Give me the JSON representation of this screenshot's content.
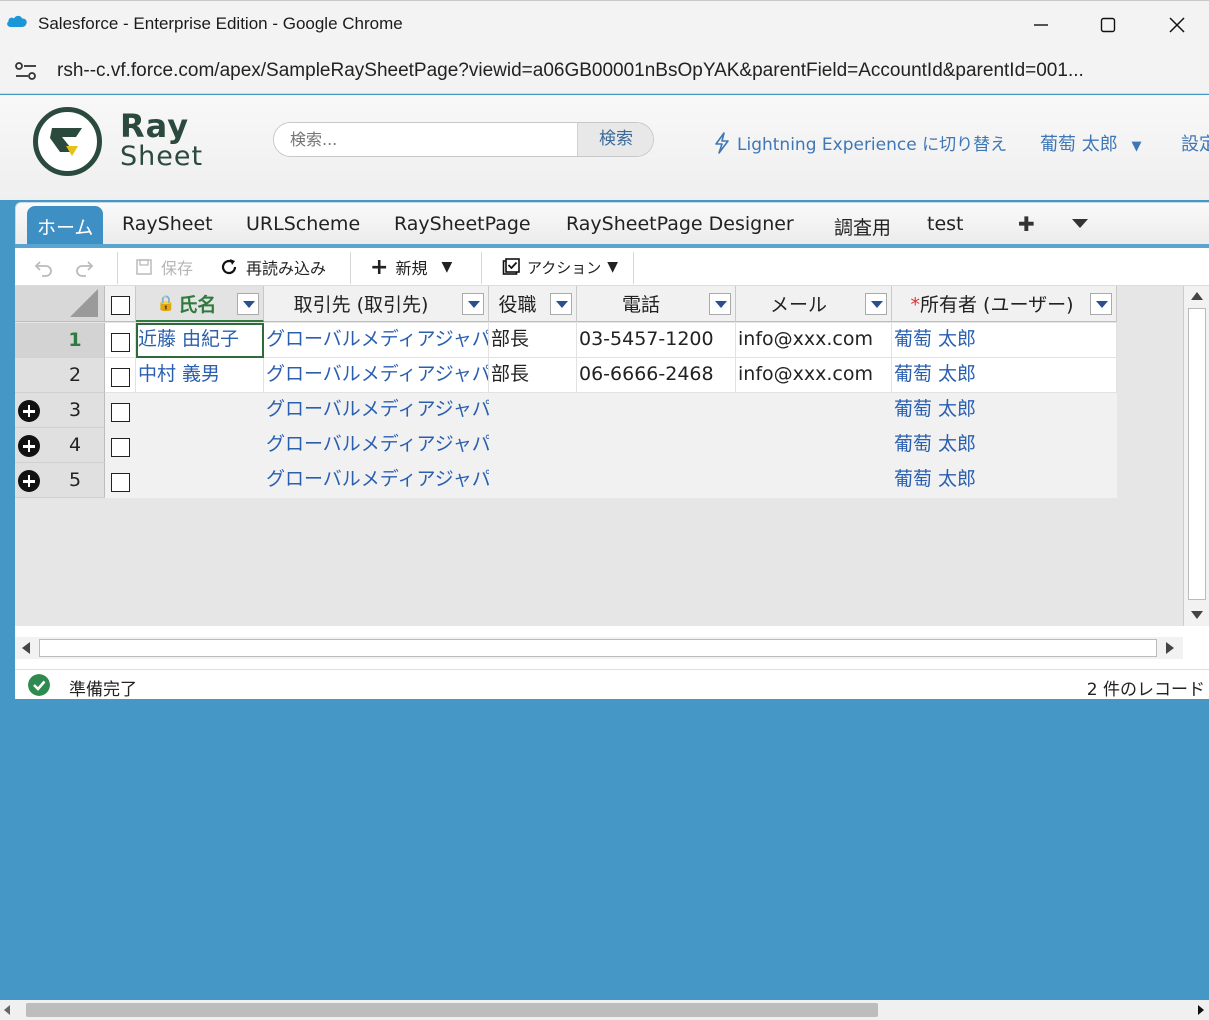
{
  "browser": {
    "title": "Salesforce - Enterprise Edition - Google Chrome",
    "url": "rsh--c.vf.force.com/apex/SampleRaySheetPage?viewid=a06GB00001nBsOpYAK&parentField=AccountId&parentId=001..."
  },
  "header": {
    "logo_top": "Ray",
    "logo_bottom": "Sheet",
    "search_placeholder": "検索...",
    "search_button": "検索",
    "lightning_link": "Lightning Experience に切り替え",
    "user_name": "葡萄 太郎",
    "settings": "設定"
  },
  "tabs": [
    "ホーム",
    "RaySheet",
    "URLScheme",
    "RaySheetPage",
    "RaySheetPage Designer",
    "調査用",
    "test"
  ],
  "toolbar": {
    "save": "保存",
    "reload": "再読み込み",
    "new": "新規",
    "action": "アクション"
  },
  "grid": {
    "columns": [
      "氏名",
      "取引先 (取引先)",
      "役職",
      "電話",
      "メール",
      "所有者 (ユーザー)"
    ],
    "required_mark": "*",
    "rows": [
      {
        "num": "1",
        "name": "近藤 由紀子",
        "account": "グローバルメディアジャパン",
        "title": "部長",
        "phone": "03-5457-1200",
        "email": "info@xxx.com",
        "owner": "葡萄 太郎"
      },
      {
        "num": "2",
        "name": "中村 義男",
        "account": "グローバルメディアジャパン",
        "title": "部長",
        "phone": "06-6666-2468",
        "email": "info@xxx.com",
        "owner": "葡萄 太郎"
      }
    ],
    "new_rows": [
      {
        "num": "3",
        "account": "グローバルメディアジャパン",
        "owner": "葡萄 太郎"
      },
      {
        "num": "4",
        "account": "グローバルメディアジャパン",
        "owner": "葡萄 太郎"
      },
      {
        "num": "5",
        "account": "グローバルメディアジャパン",
        "owner": "葡萄 太郎"
      }
    ]
  },
  "status": {
    "text": "準備完了",
    "count": "2 件のレコード"
  },
  "colors": {
    "accent": "#3d8fc4",
    "background": "#4597c5",
    "link": "#2a5fb0",
    "selected": "#2f7a3f"
  }
}
